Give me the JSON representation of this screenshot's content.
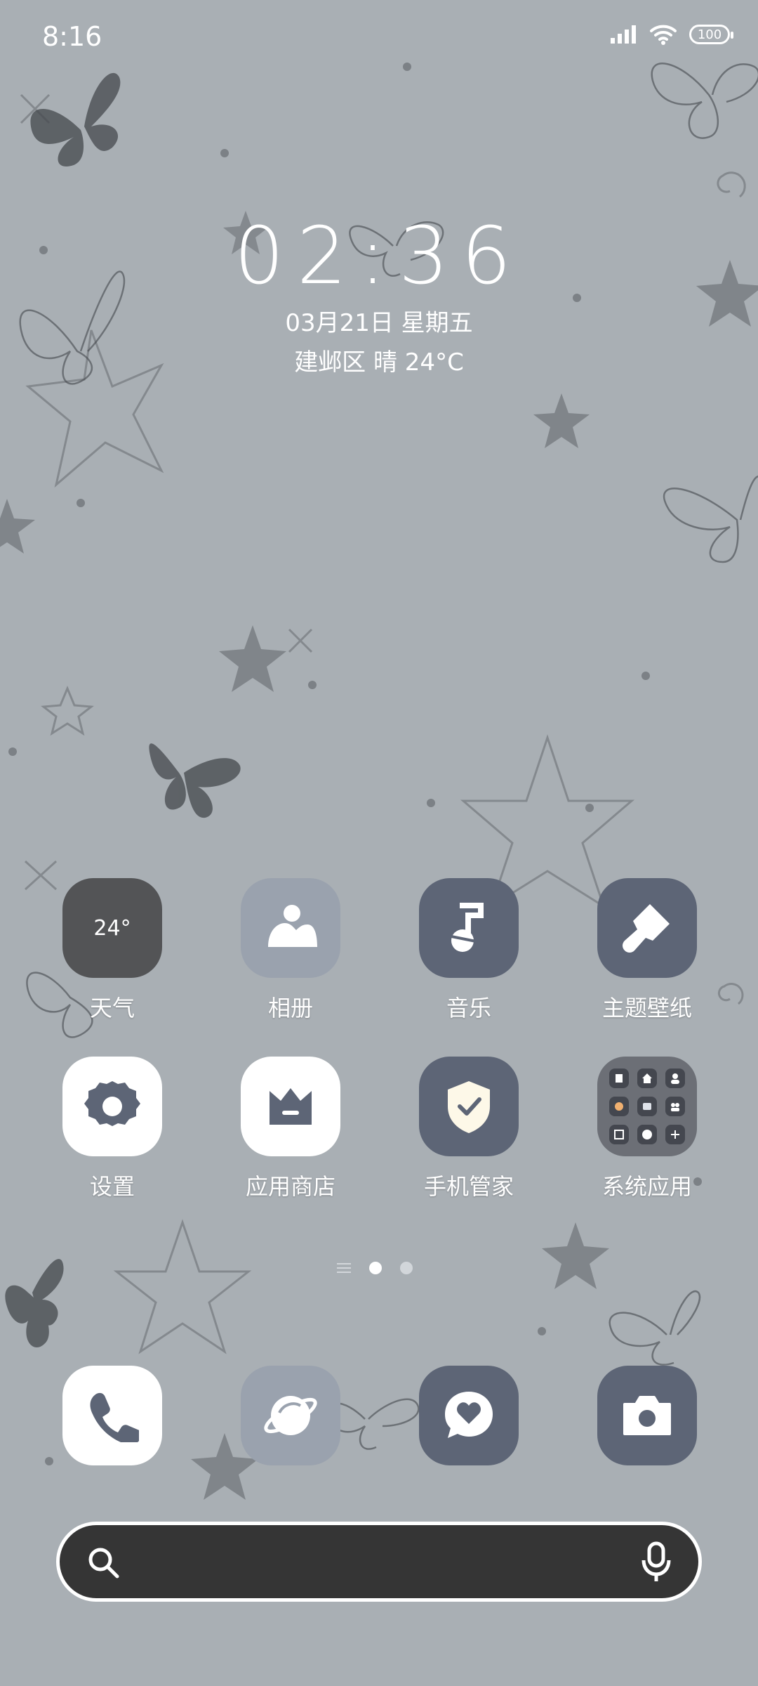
{
  "status_bar": {
    "time": "8:16",
    "battery": "100"
  },
  "clock_widget": {
    "time": "02:36",
    "date": "03月21日 星期五",
    "weather": "建邺区 晴 24°C"
  },
  "home_apps": [
    {
      "label": "天气",
      "temp": "24°"
    },
    {
      "label": "相册"
    },
    {
      "label": "音乐"
    },
    {
      "label": "主题壁纸"
    },
    {
      "label": "设置"
    },
    {
      "label": "应用商店"
    },
    {
      "label": "手机管家"
    },
    {
      "label": "系统应用"
    }
  ],
  "dock": [
    "phone-icon",
    "browser-icon",
    "messages-icon",
    "camera-icon"
  ],
  "pager": {
    "pages": 2,
    "active": 1
  }
}
